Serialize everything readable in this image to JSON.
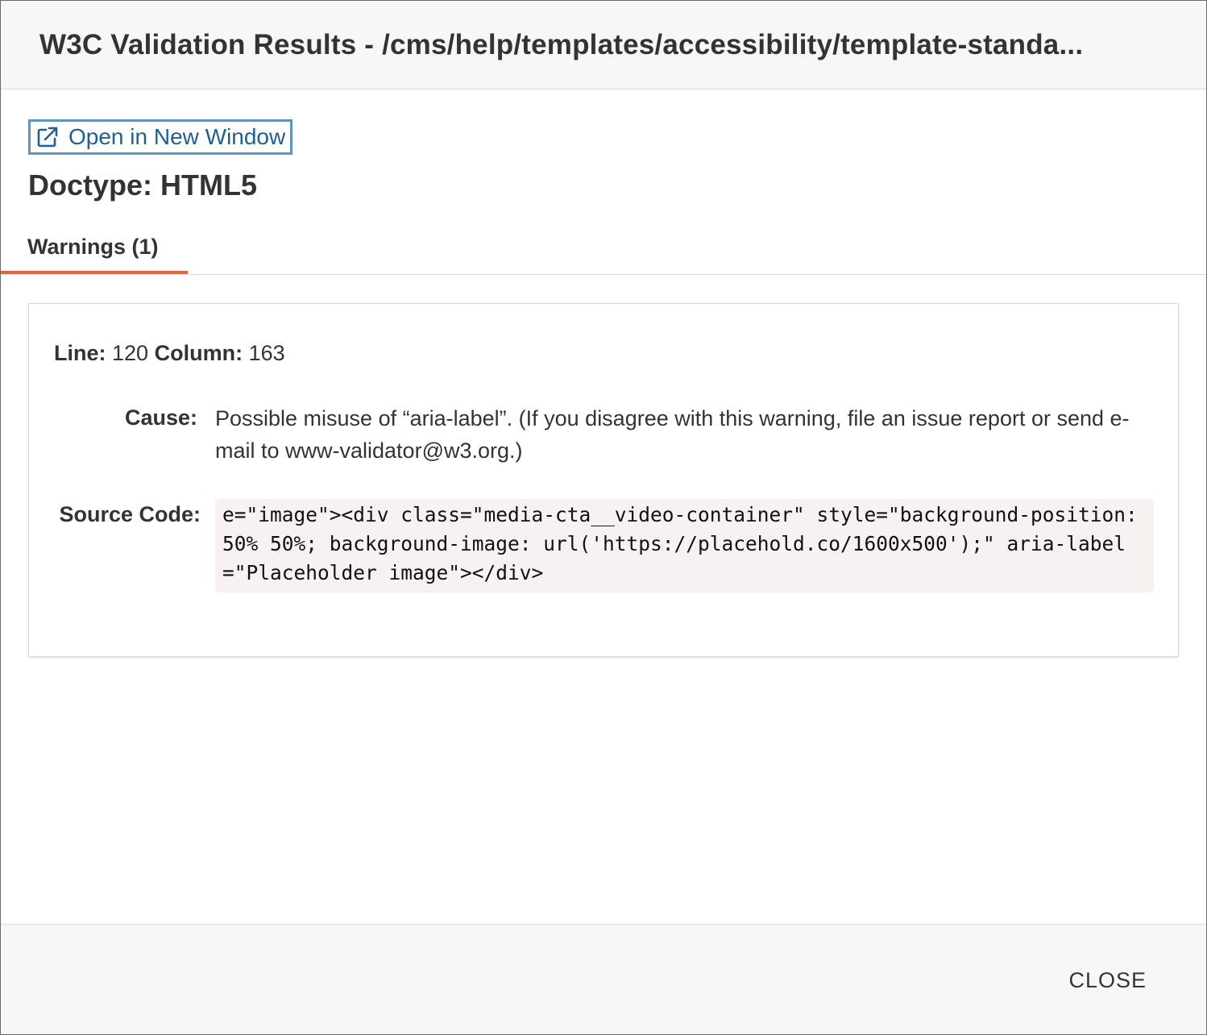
{
  "dialog": {
    "title": "W3C Validation Results - /cms/help/templates/accessibility/template-standa...",
    "open_link_label": "Open in New Window",
    "open_link_icon": "external-link-icon",
    "doctype": "Doctype: HTML5",
    "tabs": [
      {
        "label": "Warnings (1)",
        "active": true
      }
    ],
    "accent_color": "#e8623c",
    "link_color": "#1f5f93"
  },
  "warning": {
    "line_label": "Line:",
    "line_value": "120",
    "column_label": "Column:",
    "column_value": "163",
    "cause_label": "Cause:",
    "cause_text": "Possible misuse of “aria-label”. (If you disagree with this warning, file an issue report or send e-mail to www-validator@w3.org.)",
    "source_label": "Source Code:",
    "source_code": "e=\"image\"><div class=\"media-cta__video-container\" style=\"background-position:50% 50%; background-image: url('https://placehold.co/1600x500');\" aria-label=\"Placeholder image\"></div>"
  },
  "footer": {
    "close_label": "CLOSE"
  }
}
